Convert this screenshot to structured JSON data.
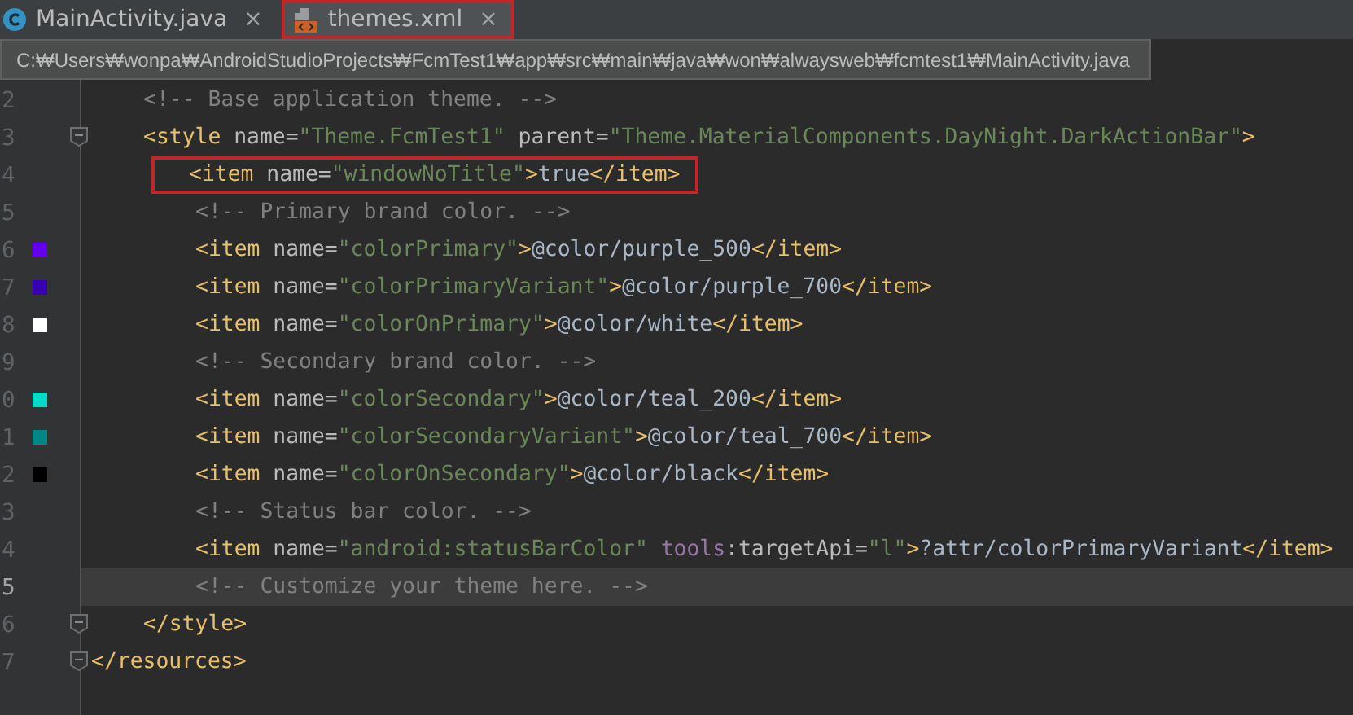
{
  "tabs": [
    {
      "label": "MainActivity.java",
      "kind": "java",
      "selected": false,
      "annotated": false,
      "close": "×"
    },
    {
      "label": "themes.xml",
      "kind": "xml",
      "selected": true,
      "annotated": true,
      "close": "×"
    }
  ],
  "tooltip": {
    "text": "C:₩Users₩wonpa₩AndroidStudioProjects₩FcmTest1₩app₩src₩main₩java₩won₩alwaysweb₩fcmtest1₩MainActivity.java"
  },
  "lines": [
    {
      "children": [
        {
          "number": "2",
          "tokens": [
            {
              "kind": "comment",
              "text": "<!-- Base application theme. -->"
            }
          ]
        },
        {
          "number": "3",
          "fold": true,
          "tokens": [
            {
              "kind": "tag",
              "text": "<style "
            },
            {
              "kind": "attr",
              "text": "name="
            },
            {
              "kind": "value",
              "text": "\"Theme.FcmTest1\" "
            },
            {
              "kind": "attr",
              "text": "parent="
            },
            {
              "kind": "value",
              "text": "\"Theme.MaterialComponents.DayNight.DarkActionBar\""
            },
            {
              "kind": "tag",
              "text": ">"
            }
          ],
          "children": [
            {
              "number": "4",
              "annotated": true,
              "tokens": [
                {
                  "kind": "tag",
                  "text": "<item "
                },
                {
                  "kind": "attr",
                  "text": "name="
                },
                {
                  "kind": "value",
                  "text": "\"windowNoTitle\""
                },
                {
                  "kind": "tag",
                  "text": ">"
                },
                {
                  "kind": "text",
                  "text": "true"
                },
                {
                  "kind": "tag",
                  "text": "</item>"
                }
              ]
            },
            {
              "number": "5",
              "tokens": [
                {
                  "kind": "comment",
                  "text": "<!-- Primary brand color. -->"
                }
              ]
            },
            {
              "number": "6",
              "color": "#6200ee",
              "tokens": [
                {
                  "kind": "tag",
                  "text": "<item "
                },
                {
                  "kind": "attr",
                  "text": "name="
                },
                {
                  "kind": "value",
                  "text": "\"colorPrimary\""
                },
                {
                  "kind": "tag",
                  "text": ">"
                },
                {
                  "kind": "text",
                  "text": "@color/purple_500"
                },
                {
                  "kind": "tag",
                  "text": "</item>"
                }
              ]
            },
            {
              "number": "7",
              "color": "#3700b3",
              "tokens": [
                {
                  "kind": "tag",
                  "text": "<item "
                },
                {
                  "kind": "attr",
                  "text": "name="
                },
                {
                  "kind": "value",
                  "text": "\"colorPrimaryVariant\""
                },
                {
                  "kind": "tag",
                  "text": ">"
                },
                {
                  "kind": "text",
                  "text": "@color/purple_700"
                },
                {
                  "kind": "tag",
                  "text": "</item>"
                }
              ]
            },
            {
              "number": "8",
              "color": "#ffffff",
              "tokens": [
                {
                  "kind": "tag",
                  "text": "<item "
                },
                {
                  "kind": "attr",
                  "text": "name="
                },
                {
                  "kind": "value",
                  "text": "\"colorOnPrimary\""
                },
                {
                  "kind": "tag",
                  "text": ">"
                },
                {
                  "kind": "text",
                  "text": "@color/white"
                },
                {
                  "kind": "tag",
                  "text": "</item>"
                }
              ]
            },
            {
              "number": "9",
              "tokens": [
                {
                  "kind": "comment",
                  "text": "<!-- Secondary brand color. -->"
                }
              ]
            },
            {
              "number": "0",
              "color": "#03dac5",
              "tokens": [
                {
                  "kind": "tag",
                  "text": "<item "
                },
                {
                  "kind": "attr",
                  "text": "name="
                },
                {
                  "kind": "value",
                  "text": "\"colorSecondary\""
                },
                {
                  "kind": "tag",
                  "text": ">"
                },
                {
                  "kind": "text",
                  "text": "@color/teal_200"
                },
                {
                  "kind": "tag",
                  "text": "</item>"
                }
              ]
            },
            {
              "number": "1",
              "color": "#018786",
              "tokens": [
                {
                  "kind": "tag",
                  "text": "<item "
                },
                {
                  "kind": "attr",
                  "text": "name="
                },
                {
                  "kind": "value",
                  "text": "\"colorSecondaryVariant\""
                },
                {
                  "kind": "tag",
                  "text": ">"
                },
                {
                  "kind": "text",
                  "text": "@color/teal_700"
                },
                {
                  "kind": "tag",
                  "text": "</item>"
                }
              ]
            },
            {
              "number": "2",
              "color": "#000000",
              "tokens": [
                {
                  "kind": "tag",
                  "text": "<item "
                },
                {
                  "kind": "attr",
                  "text": "name="
                },
                {
                  "kind": "value",
                  "text": "\"colorOnSecondary\""
                },
                {
                  "kind": "tag",
                  "text": ">"
                },
                {
                  "kind": "text",
                  "text": "@color/black"
                },
                {
                  "kind": "tag",
                  "text": "</item>"
                }
              ]
            },
            {
              "number": "3",
              "tokens": [
                {
                  "kind": "comment",
                  "text": "<!-- Status bar color. -->"
                }
              ]
            },
            {
              "number": "4",
              "tokens": [
                {
                  "kind": "tag",
                  "text": "<item "
                },
                {
                  "kind": "attr",
                  "text": "name="
                },
                {
                  "kind": "value",
                  "text": "\"android:statusBarColor\" "
                },
                {
                  "kind": "ns",
                  "text": "tools"
                },
                {
                  "kind": "attr",
                  "text": ":targetApi="
                },
                {
                  "kind": "value",
                  "text": "\"l\""
                },
                {
                  "kind": "tag",
                  "text": ">"
                },
                {
                  "kind": "text",
                  "text": "?attr/colorPrimaryVariant"
                },
                {
                  "kind": "tag",
                  "text": "</item>"
                }
              ]
            },
            {
              "number": "5",
              "current": true,
              "tokens": [
                {
                  "kind": "comment",
                  "text": "<!-- Customize your theme here. -->"
                }
              ]
            }
          ]
        },
        {
          "number": "6",
          "fold": true,
          "tokens": [
            {
              "kind": "tag",
              "text": "</style>"
            }
          ]
        }
      ]
    },
    {
      "number": "7",
      "fold": true,
      "tokens": [
        {
          "kind": "tag",
          "text": "</resources>"
        }
      ]
    }
  ]
}
